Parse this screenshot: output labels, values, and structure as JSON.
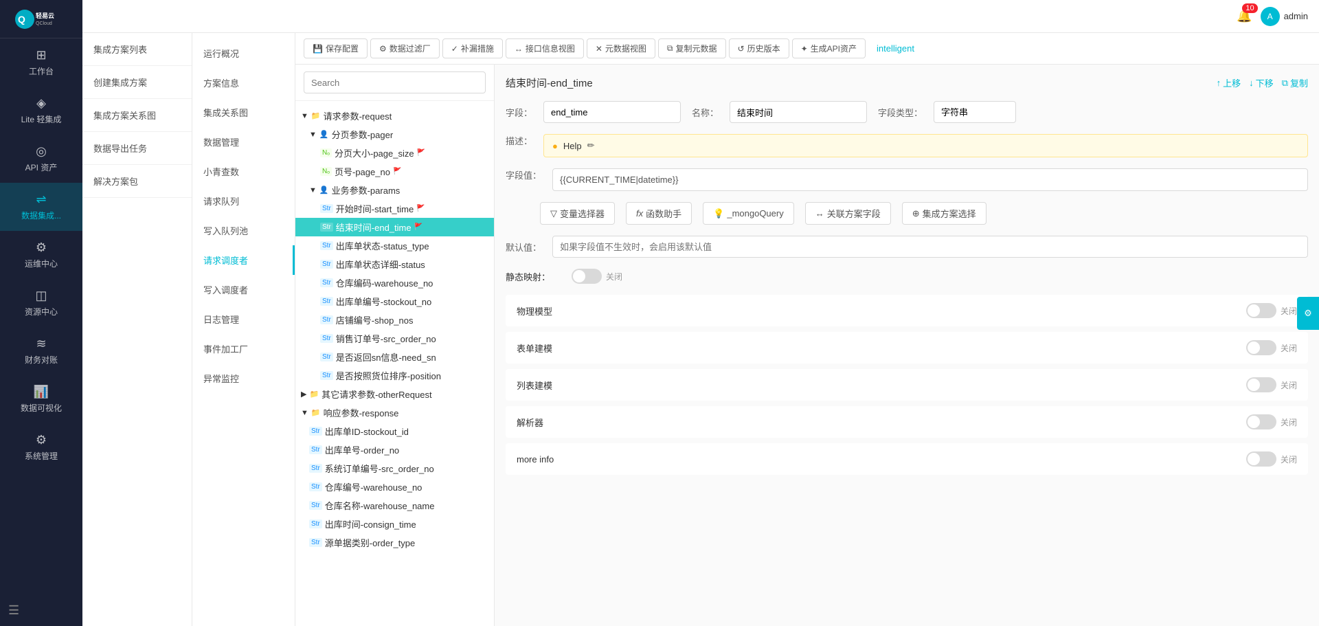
{
  "app": {
    "logo_text": "轻易云",
    "logo_sub": "QCloud"
  },
  "header": {
    "notification_count": "10",
    "user_name": "admin"
  },
  "sidebar": {
    "items": [
      {
        "id": "workbench",
        "label": "工作台",
        "icon": "⊞"
      },
      {
        "id": "lite",
        "label": "Lite 轻集成",
        "icon": "◈"
      },
      {
        "id": "api",
        "label": "API 资产",
        "icon": "◎"
      },
      {
        "id": "data",
        "label": "数据集成...",
        "icon": "⇌",
        "active": true
      },
      {
        "id": "ops",
        "label": "运维中心",
        "icon": "⚙"
      },
      {
        "id": "resource",
        "label": "资源中心",
        "icon": "◫"
      },
      {
        "id": "finance",
        "label": "财务对账",
        "icon": "₿"
      },
      {
        "id": "visual",
        "label": "数据可视化",
        "icon": "📊"
      },
      {
        "id": "system",
        "label": "系统管理",
        "icon": "⚙"
      }
    ]
  },
  "secondary_sidebar": {
    "items": [
      {
        "id": "solution-list",
        "label": "集成方案列表"
      },
      {
        "id": "create-solution",
        "label": "创建集成方案"
      },
      {
        "id": "solution-map",
        "label": "集成方案关系图"
      },
      {
        "id": "data-export",
        "label": "数据导出任务"
      },
      {
        "id": "solution-pkg",
        "label": "解决方案包"
      }
    ]
  },
  "operation_panel": {
    "items": [
      {
        "id": "overview",
        "label": "运行概况"
      },
      {
        "id": "solution-info",
        "label": "方案信息"
      },
      {
        "id": "integration-map",
        "label": "集成关系图"
      },
      {
        "id": "data-mgmt",
        "label": "数据管理"
      },
      {
        "id": "query-count",
        "label": "小青查数"
      },
      {
        "id": "request-queue",
        "label": "请求队列"
      },
      {
        "id": "write-queue",
        "label": "写入队列池"
      },
      {
        "id": "request-debugger",
        "label": "请求调度者",
        "active": true
      },
      {
        "id": "write-debugger",
        "label": "写入调度者"
      },
      {
        "id": "log-mgmt",
        "label": "日志管理"
      },
      {
        "id": "event-factory",
        "label": "事件加工厂"
      },
      {
        "id": "anomaly-monitor",
        "label": "异常监控"
      }
    ]
  },
  "toolbar": {
    "buttons": [
      {
        "id": "save-config",
        "label": "保存配置",
        "icon": "💾"
      },
      {
        "id": "data-filter",
        "label": "数据过滤厂",
        "icon": "⚙"
      },
      {
        "id": "supplement",
        "label": "补漏措施",
        "icon": "✓"
      },
      {
        "id": "interface-view",
        "label": "接口信息视图",
        "icon": "↔"
      },
      {
        "id": "meta-view",
        "label": "元数据视图",
        "icon": "✕"
      },
      {
        "id": "copy-meta",
        "label": "复制元数据",
        "icon": "⧉"
      },
      {
        "id": "history",
        "label": "历史版本",
        "icon": "↺"
      },
      {
        "id": "gen-api",
        "label": "生成API资产",
        "icon": "✦"
      },
      {
        "id": "intelligent",
        "label": "intelligent",
        "active": true
      }
    ]
  },
  "search": {
    "placeholder": "Search"
  },
  "tree": {
    "nodes": [
      {
        "id": "request-params",
        "label": "请求参数-request",
        "level": 0,
        "type": "folder",
        "expanded": true
      },
      {
        "id": "pager",
        "label": "分页参数-pager",
        "level": 1,
        "type": "user",
        "expanded": true
      },
      {
        "id": "page-size",
        "label": "分页大小-page_size",
        "level": 2,
        "type": "no",
        "flag": "red"
      },
      {
        "id": "page-no",
        "label": "页号-page_no",
        "level": 2,
        "type": "no",
        "flag": "red"
      },
      {
        "id": "params",
        "label": "业务参数-params",
        "level": 1,
        "type": "user",
        "expanded": true
      },
      {
        "id": "start-time",
        "label": "开始时间-start_time",
        "level": 2,
        "type": "str",
        "flag": "red"
      },
      {
        "id": "end-time",
        "label": "结束时间-end_time",
        "level": 2,
        "type": "str",
        "flag": "red",
        "selected": true,
        "highlighted": true
      },
      {
        "id": "status-type",
        "label": "出库单状态-status_type",
        "level": 2,
        "type": "str"
      },
      {
        "id": "status-detail",
        "label": "出库单状态详细-status",
        "level": 2,
        "type": "str"
      },
      {
        "id": "warehouse-no",
        "label": "仓库编码-warehouse_no",
        "level": 2,
        "type": "str"
      },
      {
        "id": "stockout-no",
        "label": "出库单编号-stockout_no",
        "level": 2,
        "type": "str"
      },
      {
        "id": "shop-nos",
        "label": "店铺编号-shop_nos",
        "level": 2,
        "type": "str"
      },
      {
        "id": "src-order-no",
        "label": "销售订单号-src_order_no",
        "level": 2,
        "type": "str"
      },
      {
        "id": "need-sn",
        "label": "是否返回sn信息-need_sn",
        "level": 2,
        "type": "str"
      },
      {
        "id": "position",
        "label": "是否按照货位排序-position",
        "level": 2,
        "type": "str"
      },
      {
        "id": "other-request",
        "label": "其它请求参数-otherRequest",
        "level": 0,
        "type": "folder"
      },
      {
        "id": "response",
        "label": "响应参数-response",
        "level": 0,
        "type": "folder",
        "expanded": true
      },
      {
        "id": "stockout-id",
        "label": "出库单ID-stockout_id",
        "level": 1,
        "type": "str"
      },
      {
        "id": "order-no",
        "label": "出库单号-order_no",
        "level": 1,
        "type": "str"
      },
      {
        "id": "src-order-no2",
        "label": "系统订单编号-src_order_no",
        "level": 1,
        "type": "str"
      },
      {
        "id": "warehouse-no2",
        "label": "仓库编号-warehouse_no",
        "level": 1,
        "type": "str"
      },
      {
        "id": "warehouse-name",
        "label": "仓库名称-warehouse_name",
        "level": 1,
        "type": "str"
      },
      {
        "id": "consign-time",
        "label": "出库时间-consign_time",
        "level": 1,
        "type": "str"
      },
      {
        "id": "order-type",
        "label": "源单据类别-order_type",
        "level": 1,
        "type": "str"
      }
    ]
  },
  "detail": {
    "title": "结束时间-end_time",
    "actions": {
      "up": "上移",
      "down": "下移",
      "copy": "复制"
    },
    "field_label": "字段：",
    "field_value": "end_time",
    "name_label": "名称：",
    "name_value": "结束时间",
    "type_label": "字段类型：",
    "type_value": "字符串",
    "desc_label": "描述：",
    "desc_help": "Help",
    "field_value_label": "字段值：",
    "field_value_content": "{{CURRENT_TIME|datetime}}",
    "action_buttons": [
      {
        "id": "var-selector",
        "label": "变量选择器",
        "icon": "▽"
      },
      {
        "id": "func-helper",
        "label": "函数助手",
        "icon": "fx"
      },
      {
        "id": "mongo-query",
        "label": "_mongoQuery",
        "icon": "💡"
      },
      {
        "id": "related-field",
        "label": "关联方案字段",
        "icon": "↔"
      },
      {
        "id": "integration-select",
        "label": "集成方案选择",
        "icon": "⊕"
      }
    ],
    "default_label": "默认值：",
    "default_placeholder": "如果字段值不生效时，会启用该默认值",
    "static_map_label": "静态映射：",
    "static_map_value": "关闭",
    "toggles": [
      {
        "id": "physical-model",
        "label": "物理模型",
        "value": "关闭"
      },
      {
        "id": "form-model",
        "label": "表单建模",
        "value": "关闭"
      },
      {
        "id": "list-model",
        "label": "列表建模",
        "value": "关闭"
      },
      {
        "id": "parser",
        "label": "解析器",
        "value": "关闭"
      },
      {
        "id": "more-info",
        "label": "more info",
        "value": "关闭"
      }
    ]
  }
}
